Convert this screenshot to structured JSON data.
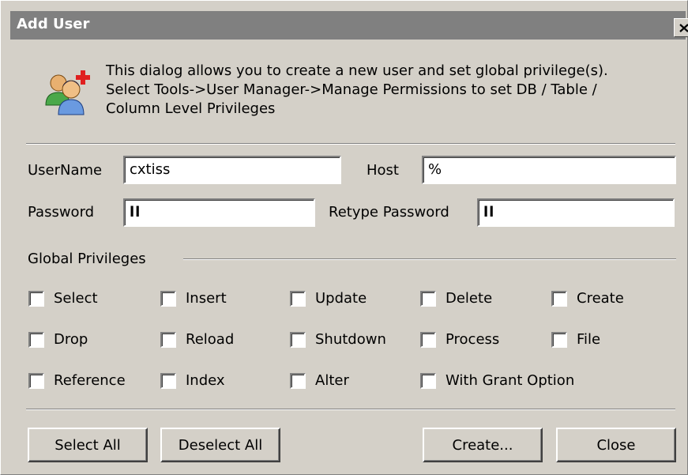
{
  "window": {
    "title": "Add User",
    "close_label": "×"
  },
  "intro": {
    "icon": "users-add-icon",
    "lines": [
      "This dialog allows you to create a new user and set global privilege(s).",
      "Select Tools->User Manager->Manage Permissions to set DB / Table /",
      "Column Level Privileges"
    ]
  },
  "form": {
    "username_label": "UserName",
    "username_value": "cxtiss",
    "host_label": "Host",
    "host_value": "%",
    "password_label": "Password",
    "password_value": "ll",
    "retype_label": "Retype Password",
    "retype_value": "ll"
  },
  "privileges": {
    "heading": "Global Privileges",
    "items": [
      {
        "label": "Select",
        "checked": false
      },
      {
        "label": "Insert",
        "checked": false
      },
      {
        "label": "Update",
        "checked": false
      },
      {
        "label": "Delete",
        "checked": false
      },
      {
        "label": "Create",
        "checked": false
      },
      {
        "label": "Drop",
        "checked": false
      },
      {
        "label": "Reload",
        "checked": false
      },
      {
        "label": "Shutdown",
        "checked": false
      },
      {
        "label": "Process",
        "checked": false
      },
      {
        "label": "File",
        "checked": false
      },
      {
        "label": "Reference",
        "checked": false
      },
      {
        "label": "Index",
        "checked": false
      },
      {
        "label": "Alter",
        "checked": false
      },
      {
        "label": "With Grant Option",
        "checked": false
      }
    ]
  },
  "buttons": {
    "select_all": "Select All",
    "deselect_all": "Deselect All",
    "create": "Create...",
    "close": "Close"
  }
}
